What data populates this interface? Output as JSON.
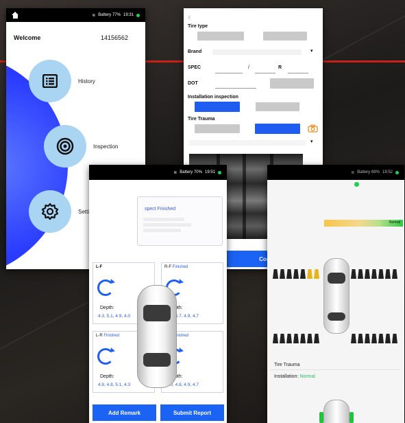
{
  "screen_home": {
    "status_battery": "Battery 77%",
    "status_time": "19:31",
    "welcome": "Welcome",
    "user_id": "14156562",
    "menu": [
      {
        "label": "History",
        "icon": "list-icon"
      },
      {
        "label": "Inspection",
        "icon": "target-icon"
      },
      {
        "label": "Setting",
        "icon": "gear-icon"
      }
    ]
  },
  "screen_form": {
    "tire_type_label": "Tire type",
    "brand_label": "Brand",
    "spec_label": "SPEC",
    "spec_sep": "/",
    "spec_r": "R",
    "dot_label": "DOT",
    "installation_label": "Installation inspection",
    "trauma_label": "Tire Trauma",
    "confirm": "Confirm"
  },
  "screen_report": {
    "status_battery": "Battery 70%",
    "status_time": "19:51",
    "remark_title": "spect Finished",
    "wheels": [
      {
        "id": "L-F",
        "status": "",
        "depth_label": "Depth:",
        "depth": "4.3, 5.1, 4.9, 4.0"
      },
      {
        "id": "R-F",
        "status": "Finished",
        "depth_label": "Depth:",
        "depth": "4.7, 4.7, 4.9, 4.7"
      },
      {
        "id": "L-R",
        "status": "Finished",
        "depth_label": "Depth:",
        "depth": "4.8, 4.8, 5.1, 4.3"
      },
      {
        "id": "R-R",
        "status": "Finished",
        "depth_label": "Depth:",
        "depth": "5.0, 4.8, 4.9, 4.7"
      }
    ],
    "add_remark": "Add Remark",
    "submit_report": "Submit Report"
  },
  "screen_detail": {
    "status_battery": "Battery 69%",
    "status_time": "19:52",
    "normal": "Normal",
    "trauma_label": "Tire Trauma",
    "installation_label": "Installation:",
    "installation_value": "Normal"
  },
  "colors": {
    "accent": "#1b63f5",
    "brand_red": "#c9201c",
    "ok_green": "#1fd14c"
  }
}
